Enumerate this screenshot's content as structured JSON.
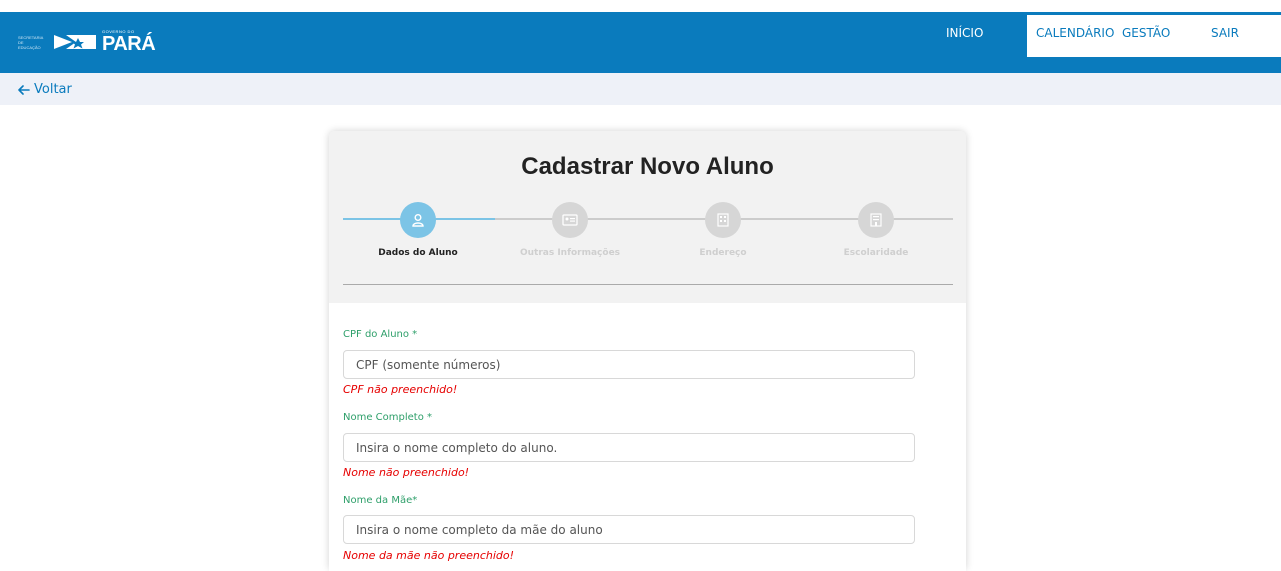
{
  "header": {
    "logo": {
      "secretaria_line1": "SECRETARIA DE",
      "secretaria_line2": "EDUCAÇÃO",
      "governo": "GOVERNO DO",
      "estado": "PARÁ"
    },
    "nav": {
      "inicio": "INÍCIO",
      "calendario": "CALENDÁRIO",
      "gestao": "GESTÃO",
      "sair": "SAIR"
    },
    "colors": {
      "brand": "#0a7bbd",
      "accent": "#7cc4e6"
    }
  },
  "subbar": {
    "back_label": "Voltar",
    "back_icon": "arrow-left-icon"
  },
  "card": {
    "title": "Cadastrar Novo Aluno",
    "steps": [
      {
        "label": "Dados do Aluno",
        "icon": "user-icon",
        "active": true
      },
      {
        "label": "Outras Informações",
        "icon": "id-card-icon",
        "active": false
      },
      {
        "label": "Endereço",
        "icon": "building-icon",
        "active": false
      },
      {
        "label": "Escolaridade",
        "icon": "school-icon",
        "active": false
      }
    ],
    "fields": [
      {
        "label": "CPF do Aluno *",
        "placeholder": "CPF (somente números)",
        "value": "",
        "error": "CPF não preenchido!"
      },
      {
        "label": "Nome Completo *",
        "placeholder": "Insira o nome completo do aluno.",
        "value": "",
        "error": "Nome não preenchido!"
      },
      {
        "label": "Nome da Mãe*",
        "placeholder": "Insira o nome completo da mãe do aluno",
        "value": "",
        "error": "Nome da mãe não preenchido!"
      }
    ]
  }
}
